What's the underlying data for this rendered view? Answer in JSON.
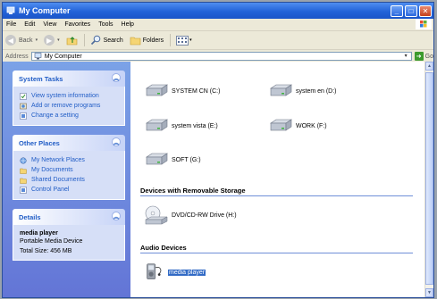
{
  "window": {
    "title": "My Computer",
    "controls": {
      "minimize": "_",
      "maximize": "□",
      "close": "✕"
    }
  },
  "menu": [
    "File",
    "Edit",
    "View",
    "Favorites",
    "Tools",
    "Help"
  ],
  "toolbar": {
    "back": "Back",
    "search": "Search",
    "folders": "Folders",
    "views_dropdown": "▾"
  },
  "address": {
    "label": "Address",
    "value": "My Computer",
    "go": "Go"
  },
  "left_pane": {
    "system_tasks": {
      "title": "System Tasks",
      "items": [
        "View system information",
        "Add or remove programs",
        "Change a setting"
      ]
    },
    "other_places": {
      "title": "Other Places",
      "items": [
        "My Network Places",
        "My Documents",
        "Shared Documents",
        "Control Panel"
      ]
    },
    "details": {
      "title": "Details",
      "name": "media player",
      "type": "Portable Media Device",
      "size": "Total Size: 456 MB"
    }
  },
  "main": {
    "drives": [
      {
        "label": "SYSTEM CN (C:)"
      },
      {
        "label": "system en (D:)"
      },
      {
        "label": "system vista (E:)"
      },
      {
        "label": "WORK (F:)"
      },
      {
        "label": "SOFT (G:)"
      }
    ],
    "removable_group": "Devices with Removable Storage",
    "removable": [
      {
        "label": "DVD/CD-RW Drive (H:)"
      }
    ],
    "audio_group": "Audio Devices",
    "audio": [
      {
        "label": "media player",
        "selected": true
      }
    ]
  },
  "colors": {
    "title_blue": "#2363d8",
    "task_link": "#215dc6",
    "selection": "#316ac5"
  }
}
